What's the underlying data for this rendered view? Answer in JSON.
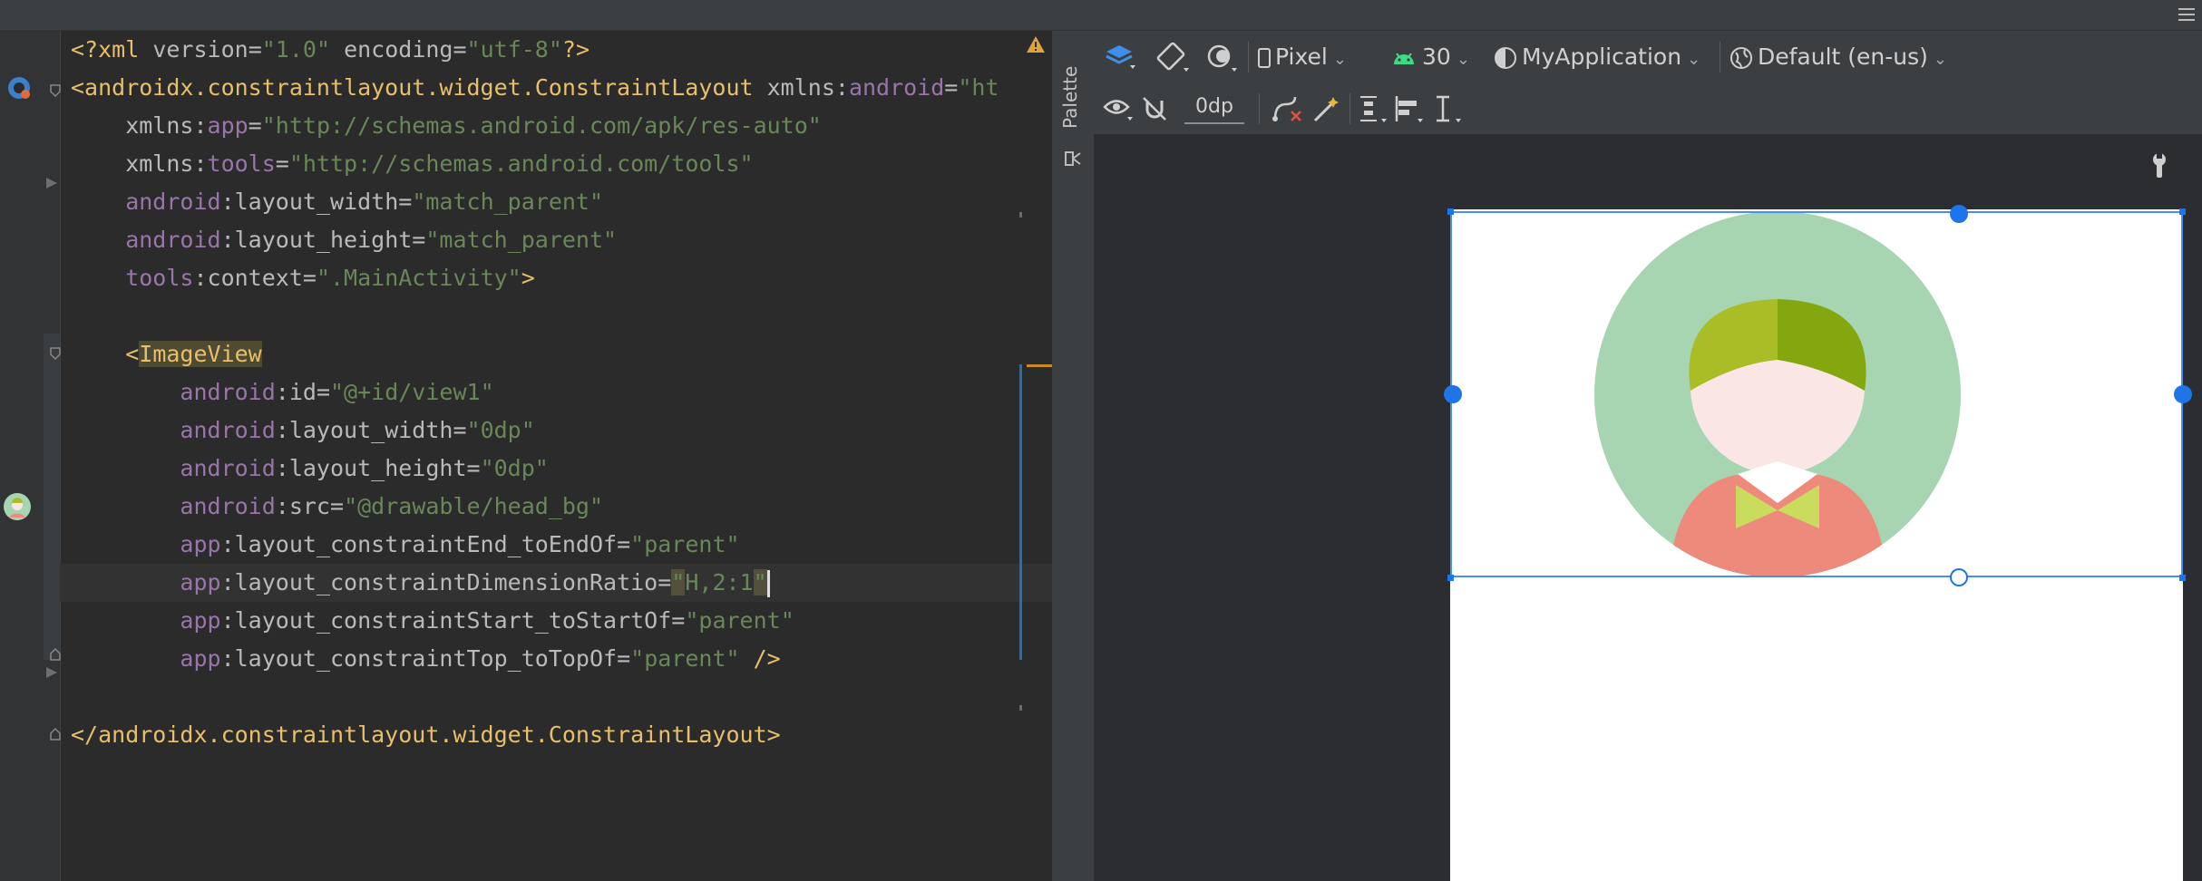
{
  "editor": {
    "lines": [
      {
        "parts": [
          "<?xml",
          " version",
          "=",
          "\"1.0\"",
          " encoding",
          "=",
          "\"utf-8\"",
          "?>"
        ]
      },
      {
        "parts": [
          "<androidx.constraintlayout.widget.ConstraintLayout",
          " xmlns:",
          "android",
          "=",
          "\"ht"
        ]
      },
      {
        "parts": [
          "    xmlns:",
          "app",
          "=",
          "\"http://schemas.android.com/apk/res-auto\""
        ]
      },
      {
        "parts": [
          "    xmlns:",
          "tools",
          "=",
          "\"http://schemas.android.com/tools\""
        ]
      },
      {
        "parts": [
          "    android",
          ":layout_width",
          "=",
          "\"match_parent\""
        ]
      },
      {
        "parts": [
          "    android",
          ":layout_height",
          "=",
          "\"match_parent\""
        ]
      },
      {
        "parts": [
          "    tools",
          ":context",
          "=",
          "\".MainActivity\"",
          ">"
        ]
      },
      {
        "parts": [
          ""
        ]
      },
      {
        "parts": [
          "    <",
          "ImageView"
        ]
      },
      {
        "parts": [
          "        android",
          ":id",
          "=",
          "\"@+id/view1\""
        ]
      },
      {
        "parts": [
          "        android",
          ":layout_width",
          "=",
          "\"0dp\""
        ]
      },
      {
        "parts": [
          "        android",
          ":layout_height",
          "=",
          "\"0dp\""
        ]
      },
      {
        "parts": [
          "        android",
          ":src",
          "=",
          "\"@drawable/head_bg\""
        ]
      },
      {
        "parts": [
          "        app",
          ":layout_constraintEnd_toEndOf",
          "=",
          "\"parent\""
        ]
      },
      {
        "parts": [
          "        app",
          ":layout_constraintDimensionRatio",
          "=",
          "\"",
          "H,2:1",
          "\""
        ]
      },
      {
        "parts": [
          "        app",
          ":layout_constraintStart_toStartOf",
          "=",
          "\"parent\""
        ]
      },
      {
        "parts": [
          "        app",
          ":layout_constraintTop_toTopOf",
          "=",
          "\"parent\"",
          " />"
        ]
      },
      {
        "parts": [
          ""
        ]
      },
      {
        "parts": [
          "</androidx.constraintlayout.widget.ConstraintLayout>"
        ]
      }
    ]
  },
  "design": {
    "palette_label": "Palette",
    "device_label": "Pixel",
    "api_label": "30",
    "theme_label": "MyApplication",
    "locale_label": "Default (en-us)",
    "margin_value": "0dp"
  },
  "colors": {
    "accent": "#1e74e8",
    "avatar_bg": "#a8d5b1",
    "hair_light": "#a9be26",
    "hair_dark": "#84a60e",
    "face": "#fbe6e6",
    "shirt": "#ee8a7c",
    "collar": "#ffffff",
    "bow": "#c9dc5e"
  }
}
